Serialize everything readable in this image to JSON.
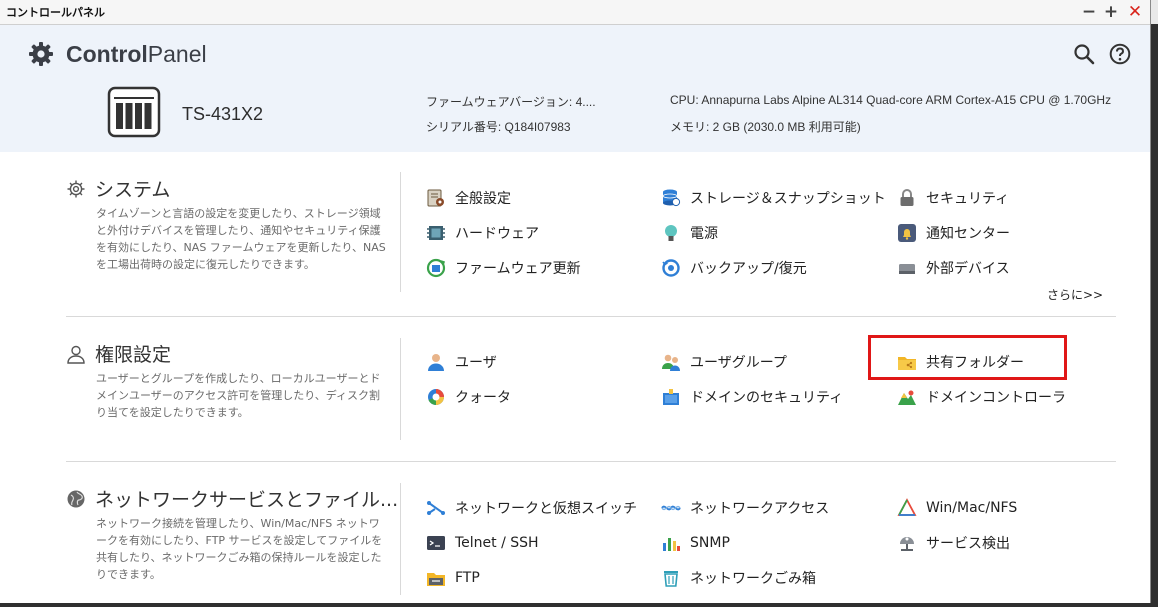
{
  "window": {
    "title": "コントロールパネル",
    "controls": {
      "minimize": "−",
      "maximize": "+",
      "close": "✕"
    }
  },
  "header": {
    "brand_bold": "Control",
    "brand_light": "Panel",
    "icons": {
      "search": "search-icon",
      "help": "help-icon"
    }
  },
  "device": {
    "model": "TS-431X2",
    "firmware": "ファームウェアバージョン: 4....",
    "serial": "シリアル番号: Q184I07983",
    "cpu": "CPU: Annapurna Labs Alpine AL314 Quad-core ARM Cortex-A15 CPU @ 1.70GHz",
    "memory": "メモリ: 2 GB (2030.0 MB 利用可能)"
  },
  "sections": [
    {
      "title": "システム",
      "description": "タイムゾーンと言語の設定を変更したり、ストレージ領域と外付けデバイスを管理したり、通知やセキュリティ保護を有効にしたり、NAS ファームウェアを更新したり、NAS を工場出荷時の設定に復元したりできます。",
      "items": [
        "全般設定",
        "ストレージ＆スナップショット",
        "セキュリティ",
        "ハードウェア",
        "電源",
        "通知センター",
        "ファームウェア更新",
        "バックアップ/復元",
        "外部デバイス"
      ],
      "more": "さらに>>"
    },
    {
      "title": "権限設定",
      "description": "ユーザーとグループを作成したり、ローカルユーザーとドメインユーザーのアクセス許可を管理したり、ディスク割り当てを設定したりできます。",
      "items": [
        "ユーザ",
        "ユーザグループ",
        "共有フォルダー",
        "クォータ",
        "ドメインのセキュリティ",
        "ドメインコントローラ"
      ]
    },
    {
      "title": "ネットワークサービスとファイル...",
      "description": "ネットワーク接続を管理したり、Win/Mac/NFS ネットワークを有効にしたり、FTP サービスを設定してファイルを共有したり、ネットワークごみ箱の保持ルールを設定したりできます。",
      "items": [
        "ネットワークと仮想スイッチ",
        "ネットワークアクセス",
        "Win/Mac/NFS",
        "Telnet / SSH",
        "SNMP",
        "サービス検出",
        "FTP",
        "ネットワークごみ箱"
      ]
    }
  ],
  "colors": {
    "header_bg": "#eef3fa",
    "highlight": "#e01717",
    "accent_blue": "#2f7fd6"
  }
}
